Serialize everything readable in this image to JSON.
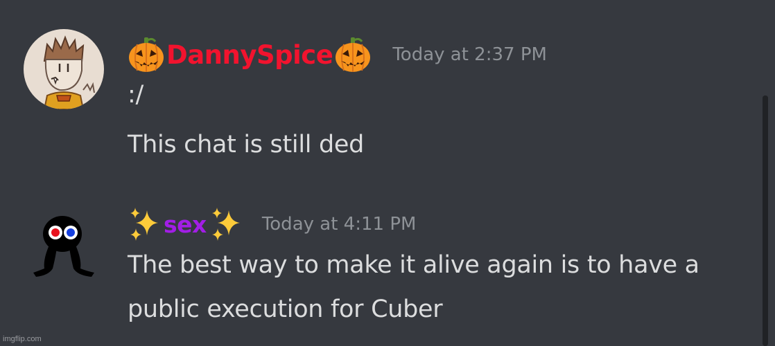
{
  "colors": {
    "background": "#36393f",
    "username_1": "#f2132e",
    "username_2": "#a21ee6",
    "timestamp": "#8e9297",
    "message_text": "#dcddde"
  },
  "messages": [
    {
      "avatar_icon": "drawn-boy-avatar-icon",
      "decoration_icon": "jack-o-lantern-icon",
      "username": "DannySpice",
      "timestamp": "Today at 2:37 PM",
      "lines": [
        ":/",
        "This chat is still ded"
      ]
    },
    {
      "avatar_icon": "black-creature-avatar-icon",
      "decoration_icon": "sparkles-icon",
      "username": "sex",
      "timestamp": "Today at 4:11 PM",
      "lines": [
        "The best way to make it alive again is to have a",
        "public execution for Cuber"
      ]
    }
  ],
  "watermark": "imgflip.com"
}
